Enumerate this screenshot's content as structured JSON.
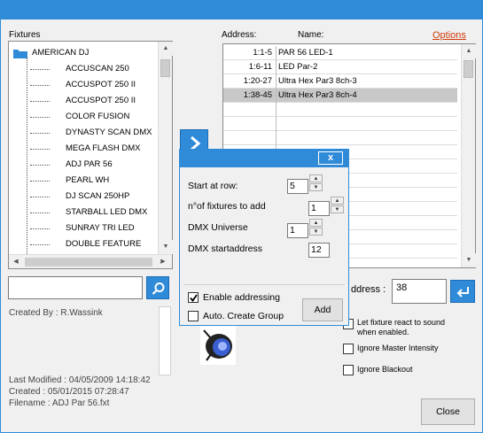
{
  "fixtures": {
    "label": "Fixtures",
    "root": "AMERICAN DJ",
    "items": [
      "ACCUSCAN 250",
      "ACCUSPOT 250 II",
      "ACCUSPOT 250 II",
      "COLOR FUSION",
      "DYNASTY SCAN DMX",
      "MEGA FLASH DMX",
      "ADJ PAR 56",
      "PEARL WH",
      "DJ SCAN 250HP",
      "STARBALL LED DMX",
      "SUNRAY TRI LED",
      "DOUBLE FEATURE"
    ]
  },
  "patch": {
    "address_header": "Address:",
    "name_header": "Name:",
    "options_link": "Options",
    "rows": [
      {
        "address": "1:1-5",
        "name": "PAR 56 LED-1"
      },
      {
        "address": "1:6-11",
        "name": "LED Par-2"
      },
      {
        "address": "1:20-27",
        "name": "Ultra Hex Par3  8ch-3"
      },
      {
        "address": "1:38-45",
        "name": "Ultra Hex Par3  8ch-4"
      }
    ],
    "selected_index": 3
  },
  "search": {
    "value": ""
  },
  "info": {
    "created_by": "Created By : R.Wassink",
    "last_modified": "Last Modified : 04/05/2009 14:18:42",
    "created": "Created : 05/01/2015 07:28:47",
    "filename": "Filename : ADJ Par 56.fxt"
  },
  "address_entry": {
    "label": "ddress :",
    "value": "38"
  },
  "options": {
    "react_sound": "Let fixture react to sound when enabled.",
    "ignore_master": "Ignore Master Intensity",
    "ignore_blackout": "Ignore Blackout"
  },
  "close_button": "Close",
  "dialog": {
    "close_glyph": "x",
    "start_row_label": "Start at row:",
    "start_row_value": "5",
    "num_fixtures_label": "n°of fixtures to add",
    "num_fixtures_value": "1",
    "dmx_universe_label": "DMX Universe",
    "dmx_universe_value": "1",
    "dmx_start_label": "DMX startaddress",
    "dmx_start_value": "12",
    "enable_addressing": "Enable addressing",
    "enable_addressing_checked": true,
    "auto_group": "Auto. Create Group",
    "auto_group_checked": false,
    "add_button": "Add"
  },
  "colors": {
    "accent": "#2f8bd8",
    "link": "#d03a0a",
    "selection": "#c8c8c8"
  }
}
